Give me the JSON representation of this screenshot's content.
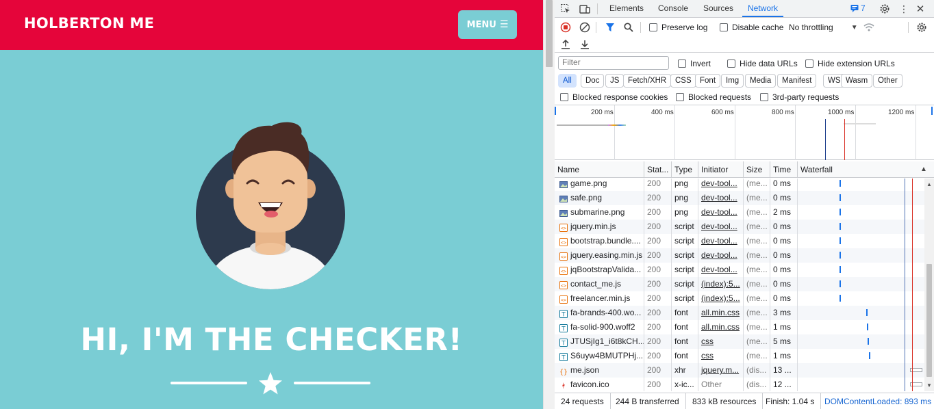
{
  "site": {
    "brand": "HOLBERTON ME",
    "menu_label": "MENU",
    "hero_title": "HI, I'M THE CHECKER!"
  },
  "devtools": {
    "tabs": [
      "Elements",
      "Console",
      "Sources",
      "Network"
    ],
    "active_tab": "Network",
    "issues_count": "7",
    "preserve_log": "Preserve log",
    "disable_cache": "Disable cache",
    "throttling": "No throttling",
    "filter_placeholder": "Filter",
    "invert": "Invert",
    "hide_data_urls": "Hide data URLs",
    "hide_extension_urls": "Hide extension URLs",
    "type_filters": [
      "All",
      "Doc",
      "JS",
      "Fetch/XHR",
      "CSS",
      "Font",
      "Img",
      "Media",
      "Manifest",
      "WS",
      "Wasm",
      "Other"
    ],
    "blocked_response_cookies": "Blocked response cookies",
    "blocked_requests": "Blocked requests",
    "third_party_requests": "3rd-party requests",
    "overview_ticks": [
      "200 ms",
      "400 ms",
      "600 ms",
      "800 ms",
      "1000 ms",
      "1200 ms"
    ],
    "columns": [
      "Name",
      "Stat...",
      "Type",
      "Initiator",
      "Size",
      "Time",
      "Waterfall"
    ],
    "rows": [
      {
        "name": "game.png",
        "status": "200",
        "type": "png",
        "initiator": "dev-tool...",
        "size": "(me...",
        "time": "0 ms",
        "icon": "image-icon"
      },
      {
        "name": "safe.png",
        "status": "200",
        "type": "png",
        "initiator": "dev-tool...",
        "size": "(me...",
        "time": "0 ms",
        "icon": "image-icon"
      },
      {
        "name": "submarine.png",
        "status": "200",
        "type": "png",
        "initiator": "dev-tool...",
        "size": "(me...",
        "time": "2 ms",
        "icon": "image-icon"
      },
      {
        "name": "jquery.min.js",
        "status": "200",
        "type": "script",
        "initiator": "dev-tool...",
        "size": "(me...",
        "time": "0 ms",
        "icon": "script-icon"
      },
      {
        "name": "bootstrap.bundle....",
        "status": "200",
        "type": "script",
        "initiator": "dev-tool...",
        "size": "(me...",
        "time": "0 ms",
        "icon": "script-icon"
      },
      {
        "name": "jquery.easing.min.js",
        "status": "200",
        "type": "script",
        "initiator": "dev-tool...",
        "size": "(me...",
        "time": "0 ms",
        "icon": "script-icon"
      },
      {
        "name": "jqBootstrapValida...",
        "status": "200",
        "type": "script",
        "initiator": "dev-tool...",
        "size": "(me...",
        "time": "0 ms",
        "icon": "script-icon"
      },
      {
        "name": "contact_me.js",
        "status": "200",
        "type": "script",
        "initiator": "(index):5...",
        "size": "(me...",
        "time": "0 ms",
        "icon": "script-icon"
      },
      {
        "name": "freelancer.min.js",
        "status": "200",
        "type": "script",
        "initiator": "(index):5...",
        "size": "(me...",
        "time": "0 ms",
        "icon": "script-icon"
      },
      {
        "name": "fa-brands-400.wo...",
        "status": "200",
        "type": "font",
        "initiator": "all.min.css",
        "size": "(me...",
        "time": "3 ms",
        "icon": "font-icon"
      },
      {
        "name": "fa-solid-900.woff2",
        "status": "200",
        "type": "font",
        "initiator": "all.min.css",
        "size": "(me...",
        "time": "1 ms",
        "icon": "font-icon"
      },
      {
        "name": "JTUSjIg1_i6t8kCH...",
        "status": "200",
        "type": "font",
        "initiator": "css",
        "size": "(me...",
        "time": "5 ms",
        "icon": "font-icon"
      },
      {
        "name": "S6uyw4BMUTPHj...",
        "status": "200",
        "type": "font",
        "initiator": "css",
        "size": "(me...",
        "time": "1 ms",
        "icon": "font-icon"
      },
      {
        "name": "me.json",
        "status": "200",
        "type": "xhr",
        "initiator": "jquery.m...",
        "size": "(dis...",
        "time": "13 ...",
        "icon": "json-icon"
      },
      {
        "name": "favicon.ico",
        "status": "200",
        "type": "x-ic...",
        "initiator": "Other",
        "size": "(dis...",
        "time": "12 ...",
        "icon": "favicon-icon"
      }
    ],
    "summary": {
      "requests": "24 requests",
      "transferred": "244 B transferred",
      "resources": "833 kB resources",
      "finish": "Finish: 1.04 s",
      "dom_content_loaded": "DOMContentLoaded: 893 ms"
    },
    "colors": {
      "accent": "#1a73e8",
      "load_line": "#d93025"
    }
  }
}
